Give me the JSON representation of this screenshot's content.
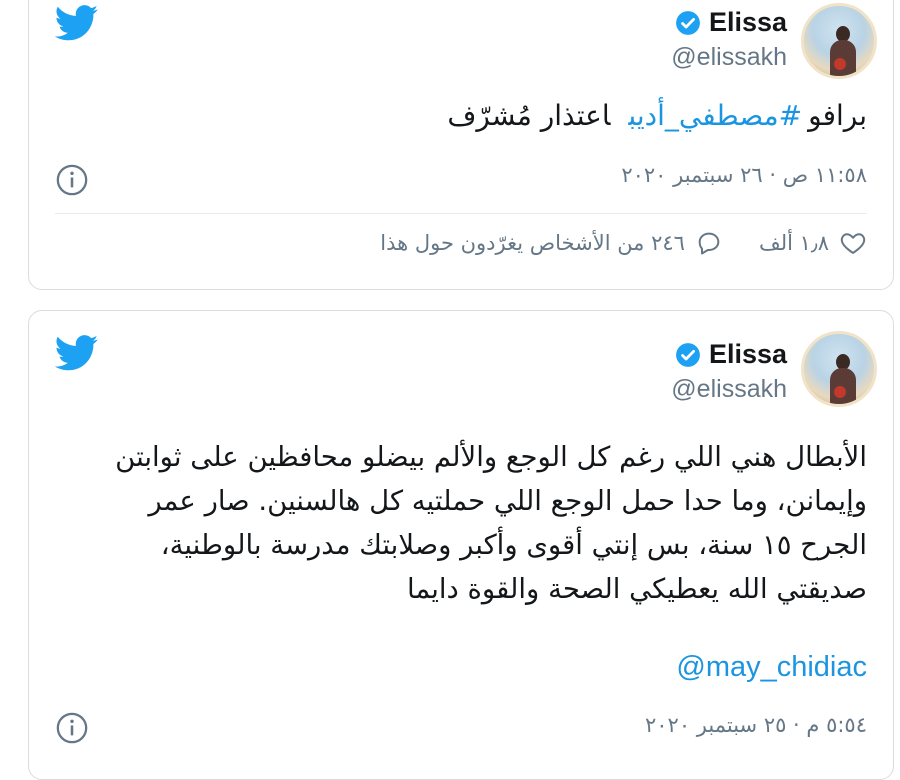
{
  "tweets": [
    {
      "author": "Elissa",
      "handle": "@elissakh",
      "text_prefix": "برافو",
      "hashtag": "#مصطفي_أديب",
      "text_suffix": "اعتذار مُشرّف",
      "timestamp": "١١:٥٨ ص · ٢٦ سبتمبر ٢٠٢٠",
      "likes": "١٫٨ ألف",
      "replies_label": "٢٤٦ من الأشخاص يغرّدون حول هذا"
    },
    {
      "author": "Elissa",
      "handle": "@elissakh",
      "text": "الأبطال هني اللي رغم كل الوجع والألم بيضلو محافظين على ثوابتن وإيمانن، وما حدا حمل الوجع اللي حملتيه كل هالسنين. صار عمر الجرح ١٥ سنة، بس إنتي أقوى وأكبر وصلابتك مدرسة بالوطنية، صديقتي الله يعطيكي الصحة والقوة دايما",
      "mention": "@may_chidiac",
      "timestamp": "٥:٥٤ م · ٢٥ سبتمبر ٢٠٢٠"
    }
  ],
  "colors": {
    "twitter_blue": "#1da1f2",
    "link_blue": "#1b95e0",
    "secondary_text": "#657786",
    "border": "#d6dde3"
  },
  "icons": [
    "twitter-logo-icon",
    "verified-badge-icon",
    "info-icon",
    "heart-icon",
    "reply-icon"
  ]
}
